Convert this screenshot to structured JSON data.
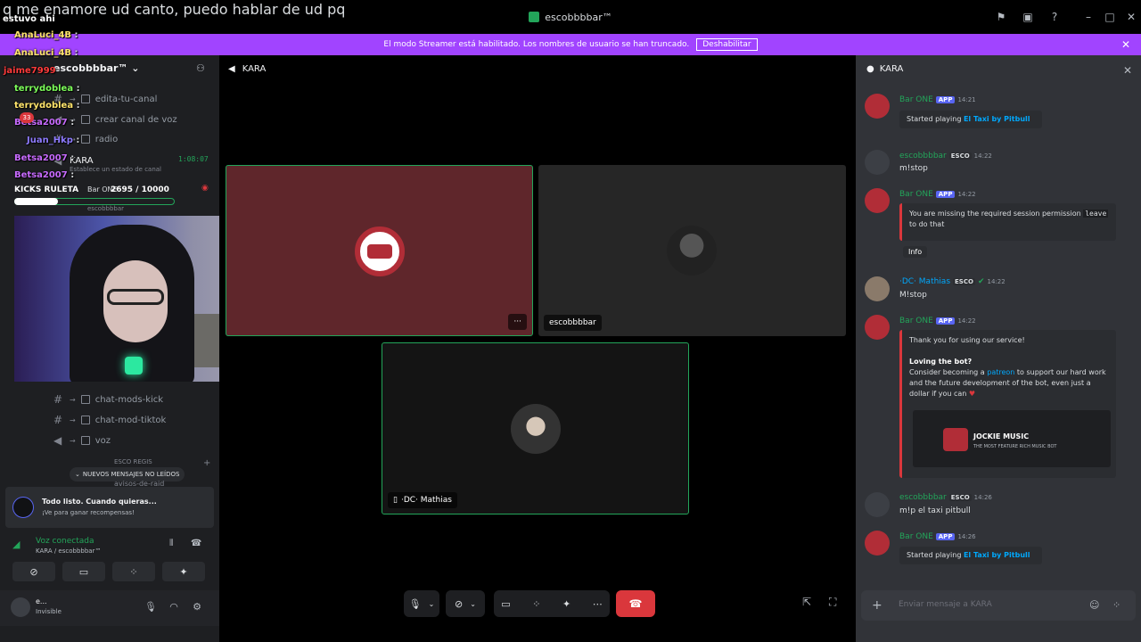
{
  "window": {
    "title": "escobbbbar™"
  },
  "banner": {
    "text": "El modo Streamer está habilitado. Los nombres de usuario se han truncado.",
    "button": "Deshabilitar"
  },
  "overlay": {
    "caption_line1": "q me enamore ud canto, puedo hablar de ud pq",
    "caption_line2": "estuvo ahi",
    "lines": [
      {
        "user": "AnaLuci_4B",
        "sep": ":",
        "color": "#ffe46b"
      },
      {
        "user": "AnaLuci_4B",
        "sep": ":",
        "color": "#ffe46b"
      },
      {
        "user": "jaime7999",
        "sep": "",
        "color": "#ff3b3b"
      },
      {
        "user": "terrydoblea",
        "sep": ":",
        "color": "#7dff5a"
      },
      {
        "user": "terrydoblea",
        "sep": ":",
        "color": "#ffe46b"
      },
      {
        "user": "Betsa2007",
        "sep": ":",
        "color": "#c86bff"
      },
      {
        "user": "Juan_Hkp",
        "sep": ":",
        "color": "#8e7bff"
      },
      {
        "user": "Betsa2007",
        "sep": ":",
        "color": "#c86bff"
      },
      {
        "user": "Betsa2007",
        "sep": ":",
        "color": "#c86bff"
      }
    ],
    "kicks_label": "KICKS RULETA",
    "kicks_progress": "2695 / 10000",
    "kicks_value": 2695,
    "kicks_goal": 10000,
    "badge_count": "33"
  },
  "sidebar": {
    "guild": "escobbbbar™",
    "channels": [
      {
        "name": "edita-tu-canal",
        "type": "text"
      },
      {
        "name": "crear canal de voz",
        "type": "voice"
      },
      {
        "name": "radio",
        "type": "text"
      }
    ],
    "voice_channel": "KARA",
    "voice_sub": "Establece un estado de canal",
    "timer": "1:08:07",
    "voice_user": "Bar ONE",
    "voice_user2": "escobbbbar",
    "channels2": [
      {
        "name": "chat-mods-kick",
        "type": "text"
      },
      {
        "name": "chat-mod-tiktok",
        "type": "text"
      },
      {
        "name": "voz",
        "type": "voice"
      }
    ],
    "category_partial": "ESCO REGIS",
    "channel_partial": "avisos-de-raid",
    "new_messages": "NUEVOS MENSAJES NO LEÍDOS",
    "notification": {
      "title": "Todo listo. Cuando quieras...",
      "subtitle": "¡Ve para ganar recompensas!"
    },
    "voice_status": {
      "title": "Voz conectada",
      "subtitle": "KARA / escobbbbar™"
    },
    "user": {
      "name": "e...",
      "status": "Invisible"
    }
  },
  "main": {
    "channel": "KARA",
    "tiles": [
      {
        "name": "",
        "speaking": true
      },
      {
        "name": "escobbbbar",
        "speaking": false
      },
      {
        "name": "·DC· Mathias",
        "speaking": true
      }
    ],
    "more": "···"
  },
  "chat": {
    "title": "KARA",
    "input_placeholder": "Enviar mensaje a KARA",
    "messages": [
      {
        "author": "Bar ONE",
        "badge": "APP",
        "time": "14:21",
        "embed_prefix": "Started playing",
        "embed_link": "El Taxi by Pitbull"
      },
      {
        "author": "escobbbbar",
        "badge": "ESCO",
        "time": "14:22",
        "text": "m!stop"
      },
      {
        "author": "Bar ONE",
        "badge": "APP",
        "time": "14:22",
        "embed_pre": "You are missing the required session permission",
        "embed_code": "leave",
        "embed_post": "to do that",
        "button": "Info"
      },
      {
        "author": "·DC· Mathias",
        "badge": "ESCO",
        "time": "14:22",
        "text": "M!stop"
      },
      {
        "author": "Bar ONE",
        "badge": "APP",
        "time": "14:22",
        "embed_line1": "Thank you for using our service!",
        "embed_bold": "Loving the bot?",
        "embed_body_pre": "Consider becoming a",
        "embed_body_link": "patreon",
        "embed_body_post": "to support our hard work and the future development of the bot, even just a dollar if you can",
        "logo_title": "JOCKIE MUSIC",
        "logo_sub": "THE MOST FEATURE RICH MUSIC BOT"
      },
      {
        "author": "escobbbbar",
        "badge": "ESCO",
        "time": "14:26",
        "text": "m!p el taxi pitbull"
      },
      {
        "author": "Bar ONE",
        "badge": "APP",
        "time": "14:26",
        "embed_prefix": "Started playing",
        "embed_link": "El Taxi by Pitbull"
      }
    ]
  },
  "colors": {
    "accent": "#5865f2",
    "speaking": "#23a55a",
    "danger": "#da373c",
    "banner": "#a144ff"
  }
}
